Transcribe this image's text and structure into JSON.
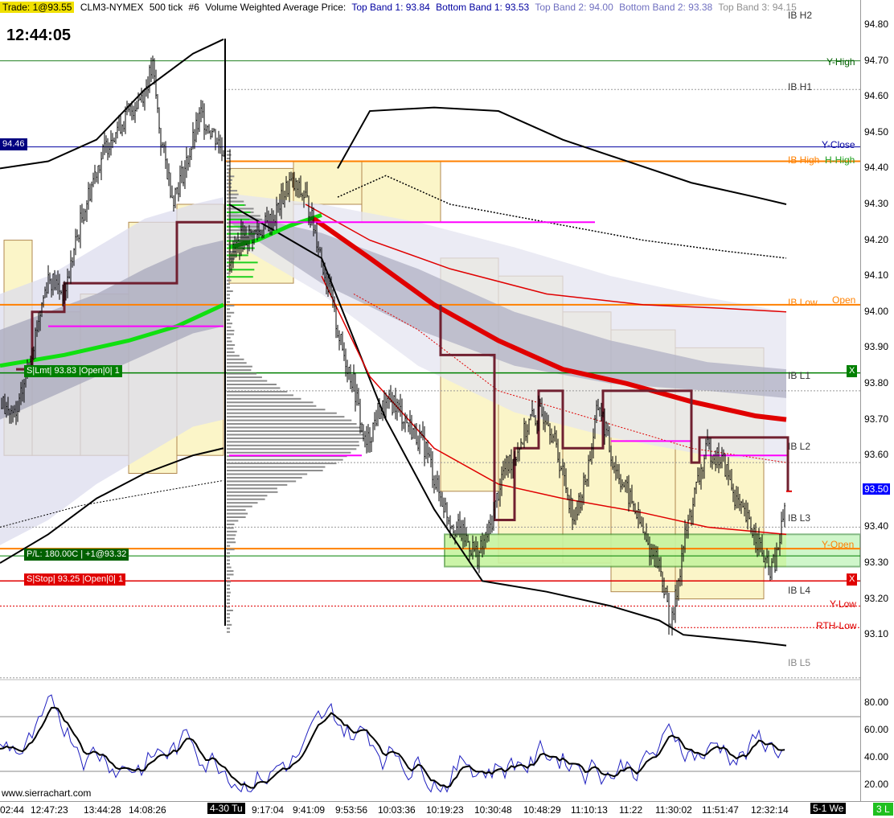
{
  "header": {
    "trade": "Trade: 1@93.55",
    "symbol": "CLM3-NYMEX",
    "period": "500 tick",
    "chart_no": "#6",
    "study": "Volume Weighted Average Price:",
    "top1": "Top Band 1: 93.84",
    "bottom1": "Bottom Band 1: 93.53",
    "top2": "Top Band 2: 94.00",
    "bottom2": "Bottom Band 2: 93.38",
    "top3": "Top Band 3: 94.15"
  },
  "clock": "12:44:05",
  "watermark": "www.sierrachart.com",
  "price_axis": {
    "labels": [
      "94.80",
      "94.70",
      "94.60",
      "94.50",
      "94.40",
      "94.30",
      "94.20",
      "94.10",
      "94.00",
      "93.90",
      "93.80",
      "93.70",
      "93.60",
      "93.50",
      "93.40",
      "93.30",
      "93.20",
      "93.10"
    ],
    "current": "93.50",
    "left_marker": "94.46"
  },
  "oscillator_axis": {
    "labels": [
      "80.00",
      "60.00",
      "40.00",
      "20.00"
    ]
  },
  "time_axis": {
    "labels": [
      "02:44",
      "12:47:23",
      "13:44:28",
      "14:08:26",
      "4-30 Tu",
      "9:17:04",
      "9:41:09",
      "9:53:56",
      "10:03:36",
      "10:19:23",
      "10:30:48",
      "10:48:29",
      "11:10:13",
      "11:22",
      "11:30:02",
      "11:51:47",
      "12:32:14",
      "5-1 We"
    ],
    "corner": "3 L"
  },
  "right_labels": {
    "ib_h2": "IB H2",
    "y_high": "Y-High",
    "ib_h1": "IB H1",
    "y_close": "Y-Close",
    "ib_high": "IB High",
    "h_high": "H-High",
    "ib_low": "IB Low",
    "open": "Open",
    "ib_l1": "IB L1",
    "ib_l2": "IB L2",
    "ib_l3": "IB L3",
    "y_open": "Y-Open",
    "ib_l4": "IB L4",
    "y_low": "Y-Low",
    "rth_low": "RTH-Low",
    "ib_l5": "IB L5"
  },
  "orders": {
    "limit": "S|Lmt| 93.83 |Open|0| 1",
    "pnl": "P/L: 180.00C | +1@93.32",
    "stop": "S|Stop| 93.25 |Open|0| 1",
    "close_x": "X"
  },
  "colors": {
    "background": "#ffffff",
    "trade_badge": "#f0e000",
    "band_blue": "#0000a0",
    "band_light_blue": "#7070c0",
    "vwap_green": "#10e010",
    "red_ma": "#e00000",
    "orange_level": "#ff8000",
    "magenta": "#ff00ff",
    "limit_order": "#008000",
    "stop_order": "#e00000",
    "value_area_fill": "#fff8b0",
    "profile_gray": "#909090"
  }
}
